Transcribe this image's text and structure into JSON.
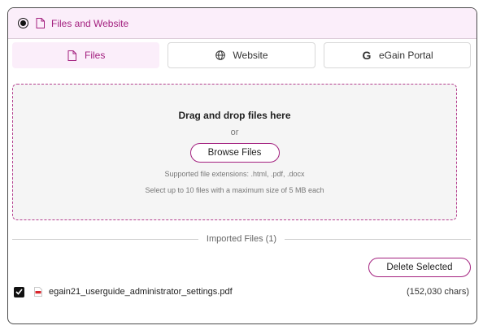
{
  "header": {
    "title": "Files and Website",
    "accent_color": "#a3207f",
    "icon": "file-icon"
  },
  "tabs": [
    {
      "label": "Files",
      "icon": "file-icon",
      "active": true
    },
    {
      "label": "Website",
      "icon": "globe-icon",
      "active": false
    },
    {
      "label": "eGain Portal",
      "icon": "g-logo-icon",
      "glyph": "G",
      "active": false
    }
  ],
  "dropzone": {
    "title": "Drag and drop files here",
    "or_text": "or",
    "browse_label": "Browse Files",
    "extensions_note": "Supported file extensions: .html, .pdf, .docx",
    "limits_note": "Select up to 10 files with a maximum size of 5 MB each"
  },
  "imported": {
    "label": "Imported Files (1)",
    "delete_label": "Delete Selected",
    "files": [
      {
        "name": "egain21_userguide_administrator_settings.pdf",
        "size": "(152,030 chars)",
        "checked": true,
        "icon": "pdf-icon"
      }
    ]
  }
}
